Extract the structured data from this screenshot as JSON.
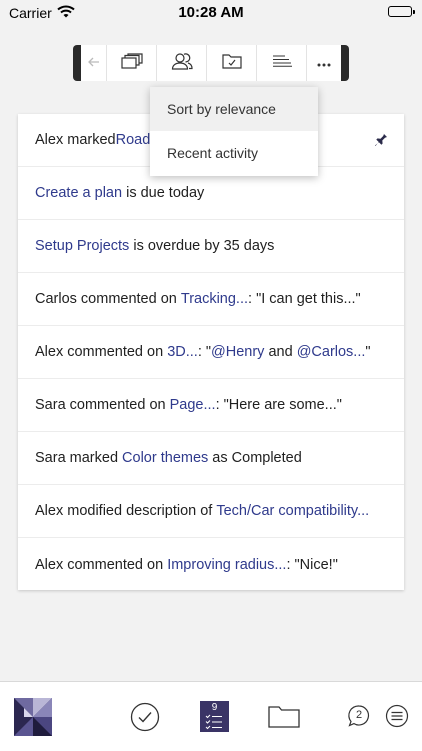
{
  "status": {
    "carrier": "Carrier",
    "time": "10:28 AM"
  },
  "toolbar": {
    "buttons": [
      {
        "icon": "back-arrow-icon"
      },
      {
        "icon": "boards-icon"
      },
      {
        "icon": "people-icon"
      },
      {
        "icon": "folder-check-icon"
      },
      {
        "icon": "sort-icon"
      },
      {
        "icon": "more-icon"
      }
    ]
  },
  "menu": {
    "options": [
      {
        "label": "Sort by relevance",
        "selected": true
      },
      {
        "label": "Recent activity",
        "selected": false
      }
    ]
  },
  "activity": [
    {
      "before": "Alex marked ",
      "link": "Road",
      "after": "",
      "pinned": true
    },
    {
      "before": "",
      "link": "Create a plan",
      "after": " is due today"
    },
    {
      "before": "",
      "link": "Setup Projects",
      "after": " is overdue by 35 days"
    },
    {
      "before": "Carlos commented on ",
      "link": "Tracking...",
      "after": ": \"I can get this...\""
    },
    {
      "before": "Alex commented on ",
      "link": "3D...",
      "after": ": \"",
      "link2": "@Henry",
      "middle": " and ",
      "link3": "@Carlos...",
      "end": "\""
    },
    {
      "before": "Sara commented on ",
      "link": "Page...",
      "after": ": \"Here are some...\""
    },
    {
      "before": "Sara marked ",
      "link": "Color themes",
      "after": " as Completed"
    },
    {
      "before": "Alex modified description of ",
      "link": "Tech/Car compatibility...",
      "after": ""
    },
    {
      "before": "Alex commented on ",
      "link": "Improving radius...",
      "after": ": \"Nice!\""
    }
  ],
  "tabbar": {
    "tasks_count": "9",
    "notifications_count": "2",
    "accent": "#3a3466"
  }
}
